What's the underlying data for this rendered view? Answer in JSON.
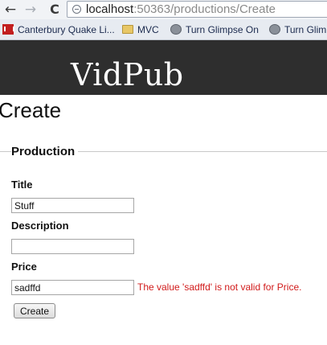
{
  "browser": {
    "url_host": "localhost",
    "url_rest": ":50363/productions/Create",
    "back_glyph": "←",
    "forward_glyph": "→",
    "reload_glyph": "C",
    "bookmarks": [
      {
        "label": "Canterbury Quake Li...",
        "icon": "seismograph-icon"
      },
      {
        "label": "MVC",
        "icon": "folder-icon"
      },
      {
        "label": "Turn Glimpse On",
        "icon": "globe-icon"
      },
      {
        "label": "Turn Glim",
        "icon": "globe-icon"
      }
    ]
  },
  "site": {
    "logo": "VidPub"
  },
  "page": {
    "title": "Create",
    "legend": "Production",
    "fields": {
      "title": {
        "label": "Title",
        "value": "Stuff"
      },
      "description": {
        "label": "Description",
        "value": ""
      },
      "price": {
        "label": "Price",
        "value": "sadffd",
        "error": "The value 'sadffd' is not valid for Price."
      }
    },
    "submit_label": "Create"
  },
  "colors": {
    "header_bg": "#2e2e2e",
    "error": "#d11a1a"
  }
}
